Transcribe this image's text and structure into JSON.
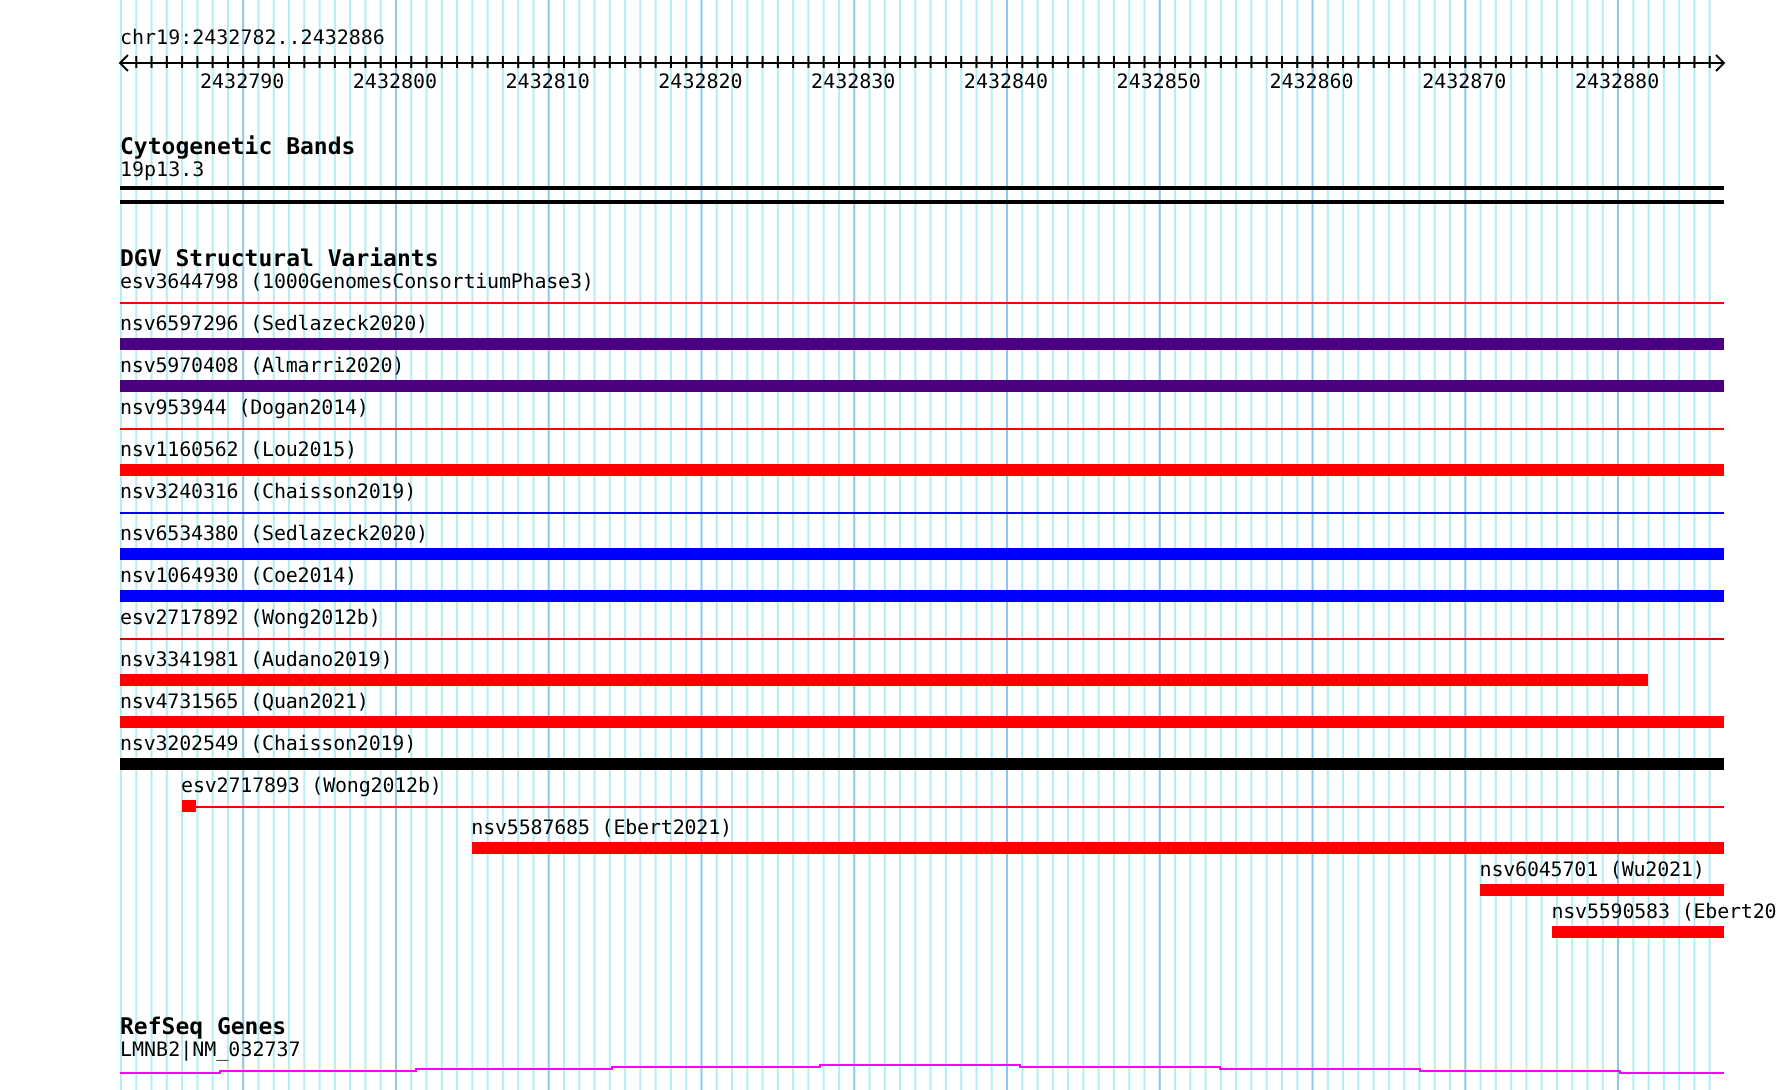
{
  "location": "chr19:2432782..2432886",
  "ruler": {
    "ticks": [
      "2432790",
      "2432800",
      "2432810",
      "2432820",
      "2432830",
      "2432840",
      "2432850",
      "2432860",
      "2432870",
      "2432880"
    ]
  },
  "cytogenetic_bands": {
    "title": "Cytogenetic Bands",
    "band": "19p13.3"
  },
  "dgv": {
    "title": "DGV Structural Variants",
    "rows": [
      {
        "label": "esv3644798 (1000GenomesConsortiumPhase3)",
        "bars": [
          {
            "kind": "thin",
            "color": "#ff0000"
          }
        ]
      },
      {
        "label": "nsv6597296 (Sedlazeck2020)",
        "bars": [
          {
            "kind": "thick",
            "color": "#4b0082"
          }
        ]
      },
      {
        "label": "nsv5970408 (Almarri2020)",
        "bars": [
          {
            "kind": "thick",
            "color": "#4b0082"
          }
        ]
      },
      {
        "label": "nsv953944 (Dogan2014)",
        "bars": [
          {
            "kind": "thin",
            "color": "#ff0000"
          }
        ]
      },
      {
        "label": "nsv1160562 (Lou2015)",
        "bars": [
          {
            "kind": "thick",
            "color": "#ff0000"
          }
        ]
      },
      {
        "label": "nsv3240316 (Chaisson2019)",
        "bars": [
          {
            "kind": "thin",
            "color": "#0000ff"
          }
        ]
      },
      {
        "label": "nsv6534380 (Sedlazeck2020)",
        "bars": [
          {
            "kind": "thick",
            "color": "#0000ff"
          }
        ]
      },
      {
        "label": "nsv1064930 (Coe2014)",
        "bars": [
          {
            "kind": "thick",
            "color": "#0000ff"
          }
        ]
      },
      {
        "label": "esv2717892 (Wong2012b)",
        "bars": [
          {
            "kind": "thin",
            "color": "#d00000"
          }
        ]
      },
      {
        "label": "nsv3341981 (Audano2019)",
        "bars": [
          {
            "kind": "thick",
            "color": "#ff0000"
          }
        ]
      },
      {
        "label": "nsv4731565 (Quan2021)",
        "bars": [
          {
            "kind": "thick",
            "color": "#ff0000"
          }
        ]
      },
      {
        "label": "nsv3202549 (Chaisson2019)",
        "bars": [
          {
            "kind": "thick",
            "color": "#000000"
          }
        ]
      },
      {
        "label": "esv2717893 (Wong2012b)",
        "bars": [
          {
            "kind": "thick",
            "color": "#ff0000"
          },
          {
            "kind": "thin",
            "color": "#ff0000"
          }
        ]
      },
      {
        "label": "nsv5587685 (Ebert2021)",
        "bars": [
          {
            "kind": "thick",
            "color": "#ff0000"
          }
        ]
      },
      {
        "label": "nsv6045701 (Wu2021)",
        "bars": [
          {
            "kind": "thick",
            "color": "#ff0000"
          }
        ]
      },
      {
        "label": "nsv5590583 (Ebert20",
        "bars": [
          {
            "kind": "thick",
            "color": "#ff0000"
          }
        ]
      }
    ]
  },
  "refseq": {
    "title": "RefSeq Genes",
    "gene": "LMNB2|NM_032737"
  }
}
